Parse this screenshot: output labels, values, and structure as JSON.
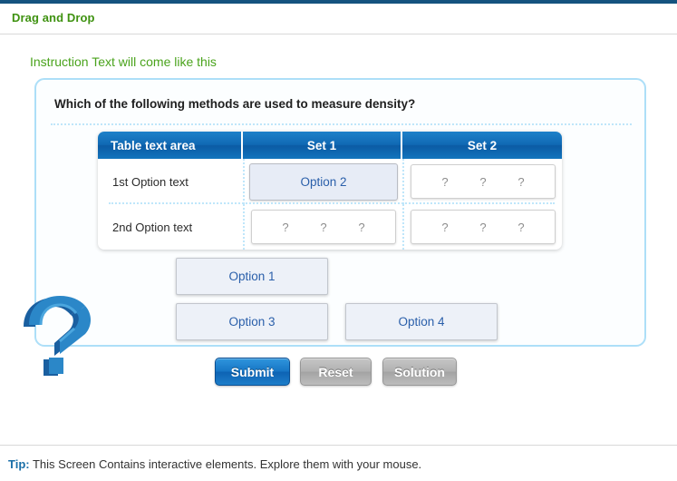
{
  "page": {
    "title": "Drag and Drop",
    "instruction": "Instruction Text will come like this"
  },
  "panel": {
    "question": "Which of the following methods are used to measure density?"
  },
  "table": {
    "headers": [
      "Table text area",
      "Set 1",
      "Set 2"
    ],
    "rows": [
      {
        "label": "1st Option text",
        "cells": [
          {
            "state": "filled",
            "text": "Option 2"
          },
          {
            "state": "empty",
            "text": "? ? ?"
          }
        ]
      },
      {
        "label": "2nd Option text",
        "cells": [
          {
            "state": "empty",
            "text": "? ? ?"
          },
          {
            "state": "empty",
            "text": "? ? ?"
          }
        ]
      }
    ],
    "placeholder_mark": "?"
  },
  "options": [
    {
      "label": "Option 1"
    },
    {
      "label": "Option 3"
    },
    {
      "label": "Option 4"
    }
  ],
  "buttons": {
    "submit": "Submit",
    "reset": "Reset",
    "solution": "Solution"
  },
  "footer": {
    "tip_label": "Tip:",
    "tip_text": " This Screen Contains interactive elements. Explore them with your mouse."
  },
  "icons": {
    "mascot": "question-mark-3d-icon"
  },
  "colors": {
    "top_bar": "#15537f",
    "title_green": "#3f9211",
    "instruction_green": "#4aa31c",
    "panel_border": "#addff8",
    "header_blue": "#1069b4",
    "option_text_blue": "#2a5faa",
    "submit_blue": "#1675c4",
    "button_gray": "#b0b0b0",
    "tip_blue": "#1a6fa8"
  }
}
